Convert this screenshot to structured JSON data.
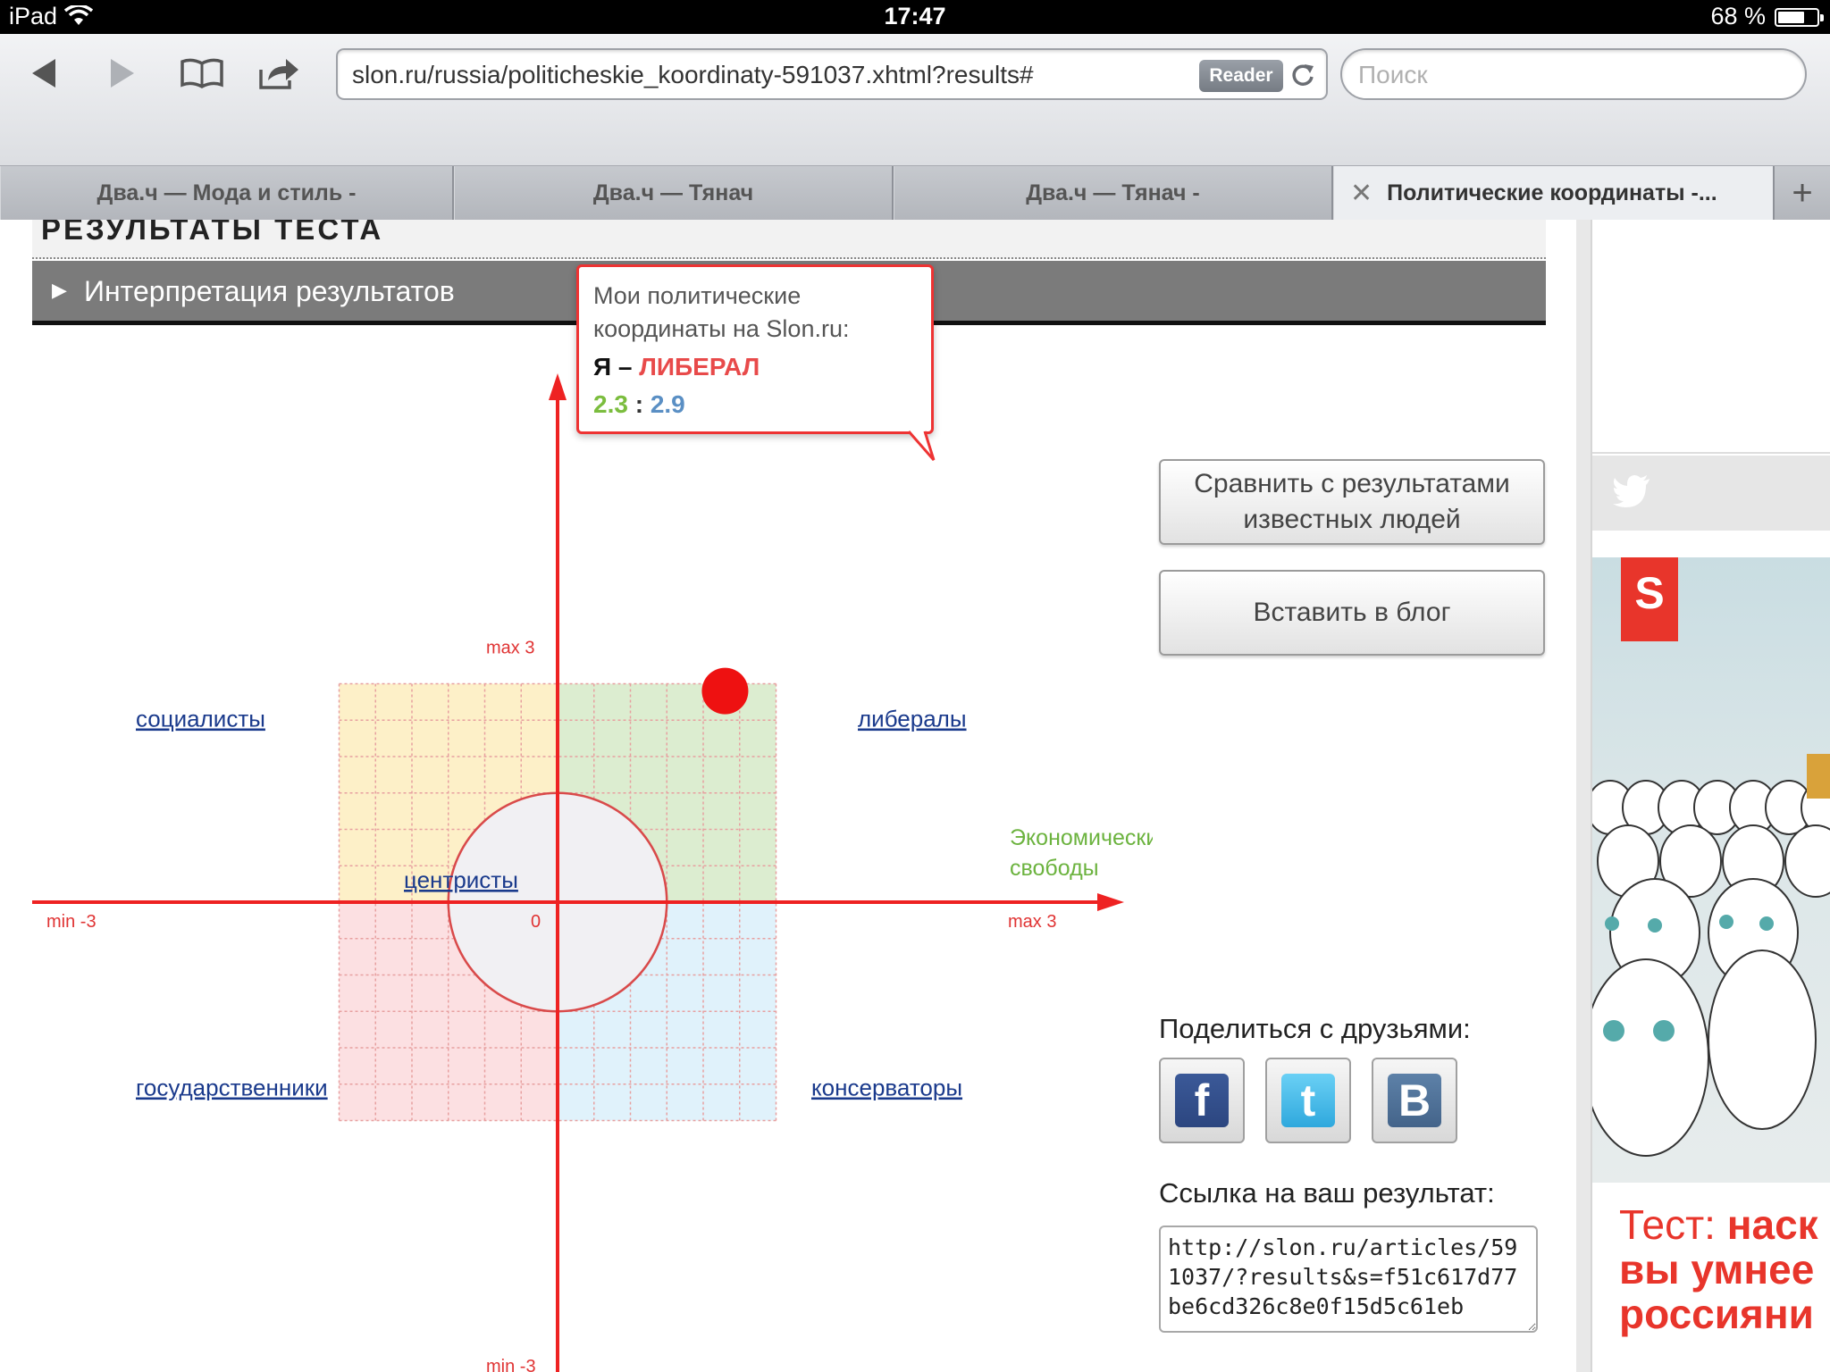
{
  "status_bar": {
    "device": "iPad",
    "time": "17:47",
    "battery_text": "68 %",
    "battery_level": 0.68
  },
  "toolbar": {
    "url": "slon.ru/russia/politicheskie_koordinaty-591037.xhtml?results#",
    "reader_label": "Reader",
    "search_placeholder": "Поиск"
  },
  "tabs": [
    {
      "label": "Два.ч — Мода и стиль -"
    },
    {
      "label": "Два.ч — Тянач"
    },
    {
      "label": "Два.ч — Тянач -"
    },
    {
      "label": "Политические координаты -..."
    }
  ],
  "page": {
    "results_heading": "РЕЗУЛЬТАТЫ ТЕСТА",
    "interpretation_label": "Интерпретация результатов",
    "popup": {
      "title": "Мои политические координаты на Slon.ru:",
      "result_prefix": "Я –",
      "result_label": "ЛИБЕРАЛ",
      "coord_x": "2.3",
      "coord_sep": ":",
      "coord_y": "2.9"
    },
    "compare_button": "Сравнить с результатами известных людей",
    "embed_button": "Вставить в блог",
    "share_label": "Поделиться с друзьями:",
    "link_label": "Ссылка на ваш результат:",
    "link_value": "http://slon.ru/articles/591037/?results&s=f51c617d77be6cd326c8e0f15d5c61eb"
  },
  "chart_data": {
    "type": "scatter",
    "xlim": [
      -3,
      3
    ],
    "ylim": [
      -3,
      3
    ],
    "x_min_label": "min -3",
    "x_max_label": "max 3",
    "y_max_label": "max 3",
    "y_min_label": "min -3",
    "origin_label": "0",
    "x_axis_label": "Экономические свободы",
    "grid": true,
    "quadrants": [
      {
        "name": "социалисты",
        "color": "#fdf0c8"
      },
      {
        "name": "либералы",
        "color": "#dcedd0"
      },
      {
        "name": "государственники",
        "color": "#fce0e2"
      },
      {
        "name": "консерваторы",
        "color": "#e0f2fb"
      }
    ],
    "center_region": {
      "name": "центристы",
      "radius": 1.5,
      "color": "#f1f0f3"
    },
    "points": [
      {
        "x": 2.3,
        "y": 2.9
      }
    ],
    "axis_color": "#ee2222"
  },
  "sidebar": {
    "ad_text_line1a": "Тест: ",
    "ad_text_line1b": "наск",
    "ad_text_line2": "вы умнее",
    "ad_text_line3": "россияни",
    "ad_logo": "S"
  }
}
